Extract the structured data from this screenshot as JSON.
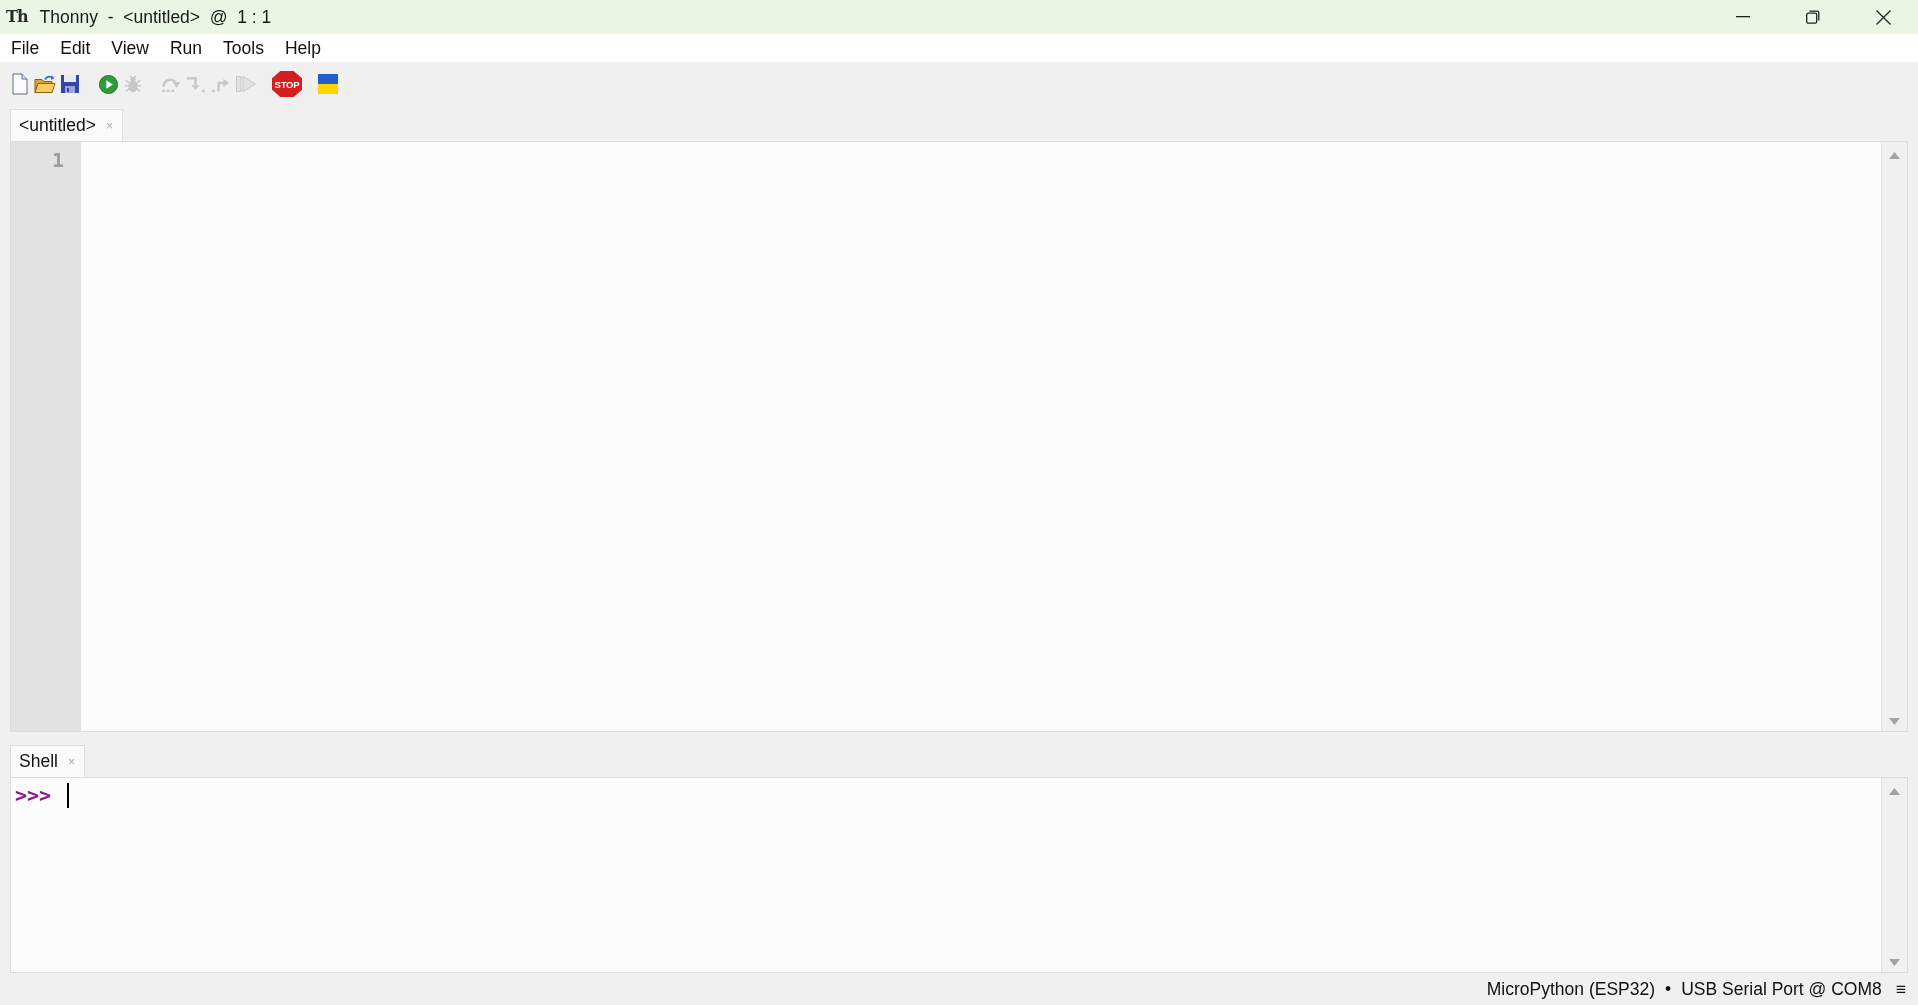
{
  "window": {
    "logo": "Th",
    "title": "Thonny  -  <untitled>  @  1 : 1"
  },
  "menu": [
    "File",
    "Edit",
    "View",
    "Run",
    "Tools",
    "Help"
  ],
  "toolbar": [
    {
      "buttons": [
        {
          "kind": "new",
          "disabled": false
        },
        {
          "kind": "open",
          "disabled": false
        },
        {
          "kind": "save",
          "disabled": false
        }
      ]
    },
    {
      "buttons": [
        {
          "kind": "run",
          "disabled": false
        },
        {
          "kind": "debug",
          "disabled": true
        }
      ]
    },
    {
      "buttons": [
        {
          "kind": "step_over",
          "disabled": true
        },
        {
          "kind": "step_into",
          "disabled": true
        },
        {
          "kind": "step_out",
          "disabled": true
        },
        {
          "kind": "resume",
          "disabled": true
        }
      ]
    },
    {
      "buttons": [
        {
          "kind": "stop",
          "disabled": false,
          "label": "STOP"
        }
      ]
    },
    {
      "buttons": [
        {
          "kind": "flag",
          "disabled": false
        }
      ]
    }
  ],
  "editor": {
    "tabs": [
      {
        "label": "<untitled>",
        "close": "×",
        "selected": true
      }
    ],
    "line_numbers": [
      "1"
    ]
  },
  "shell": {
    "tabs": [
      {
        "label": "Shell",
        "close": "×",
        "selected": true
      }
    ],
    "prompt": ">>>"
  },
  "status_bar": {
    "interpreter": "MicroPython (ESP32)",
    "separator": "•",
    "port": "USB Serial Port @ COM8",
    "menu": "≡"
  }
}
